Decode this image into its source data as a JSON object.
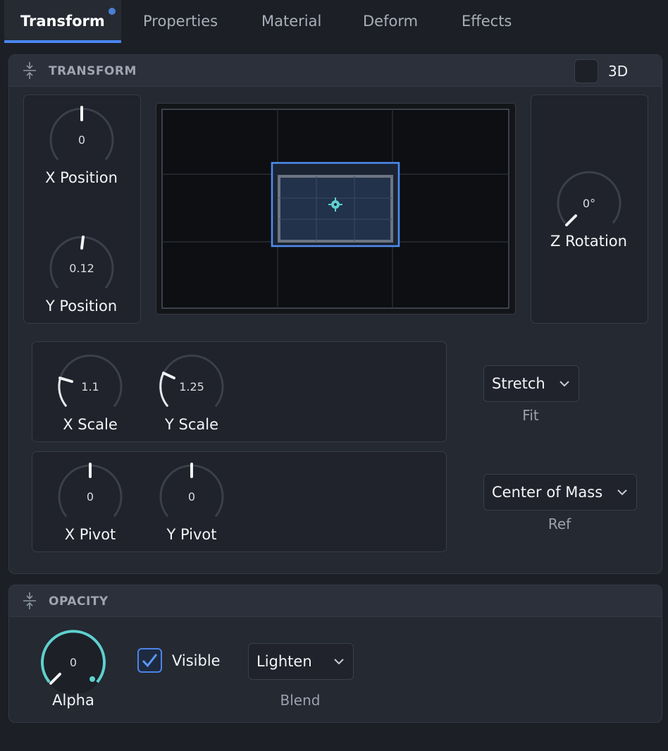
{
  "tabs": [
    {
      "label": "Transform",
      "active": true
    },
    {
      "label": "Properties"
    },
    {
      "label": "Material"
    },
    {
      "label": "Deform"
    },
    {
      "label": "Effects"
    }
  ],
  "transform": {
    "title": "TRANSFORM",
    "toggle_3d_label": "3D",
    "toggle_3d_checked": false,
    "x_position": {
      "label": "X Position",
      "value": "0"
    },
    "y_position": {
      "label": "Y Position",
      "value": "0.12"
    },
    "z_rotation": {
      "label": "Z Rotation",
      "value": "0°"
    },
    "x_scale": {
      "label": "X Scale",
      "value": "1.1"
    },
    "y_scale": {
      "label": "Y Scale",
      "value": "1.25"
    },
    "x_pivot": {
      "label": "X Pivot",
      "value": "0"
    },
    "y_pivot": {
      "label": "Y Pivot",
      "value": "0"
    },
    "fit": {
      "label": "Fit",
      "selected": "Stretch"
    },
    "ref": {
      "label": "Ref",
      "selected": "Center of Mass"
    }
  },
  "opacity": {
    "title": "OPACITY",
    "alpha": {
      "label": "Alpha",
      "value": "0"
    },
    "visible": {
      "label": "Visible",
      "checked": true
    },
    "blend": {
      "label": "Blend",
      "selected": "Lighten"
    }
  },
  "colors": {
    "accent": "#4a86ef",
    "alpha_ring": "#5fd0cf",
    "background": "#1c1f26"
  },
  "icons": [
    "collapse-icon",
    "chevron-down-icon",
    "checkmark-icon",
    "crosshair-icon"
  ]
}
